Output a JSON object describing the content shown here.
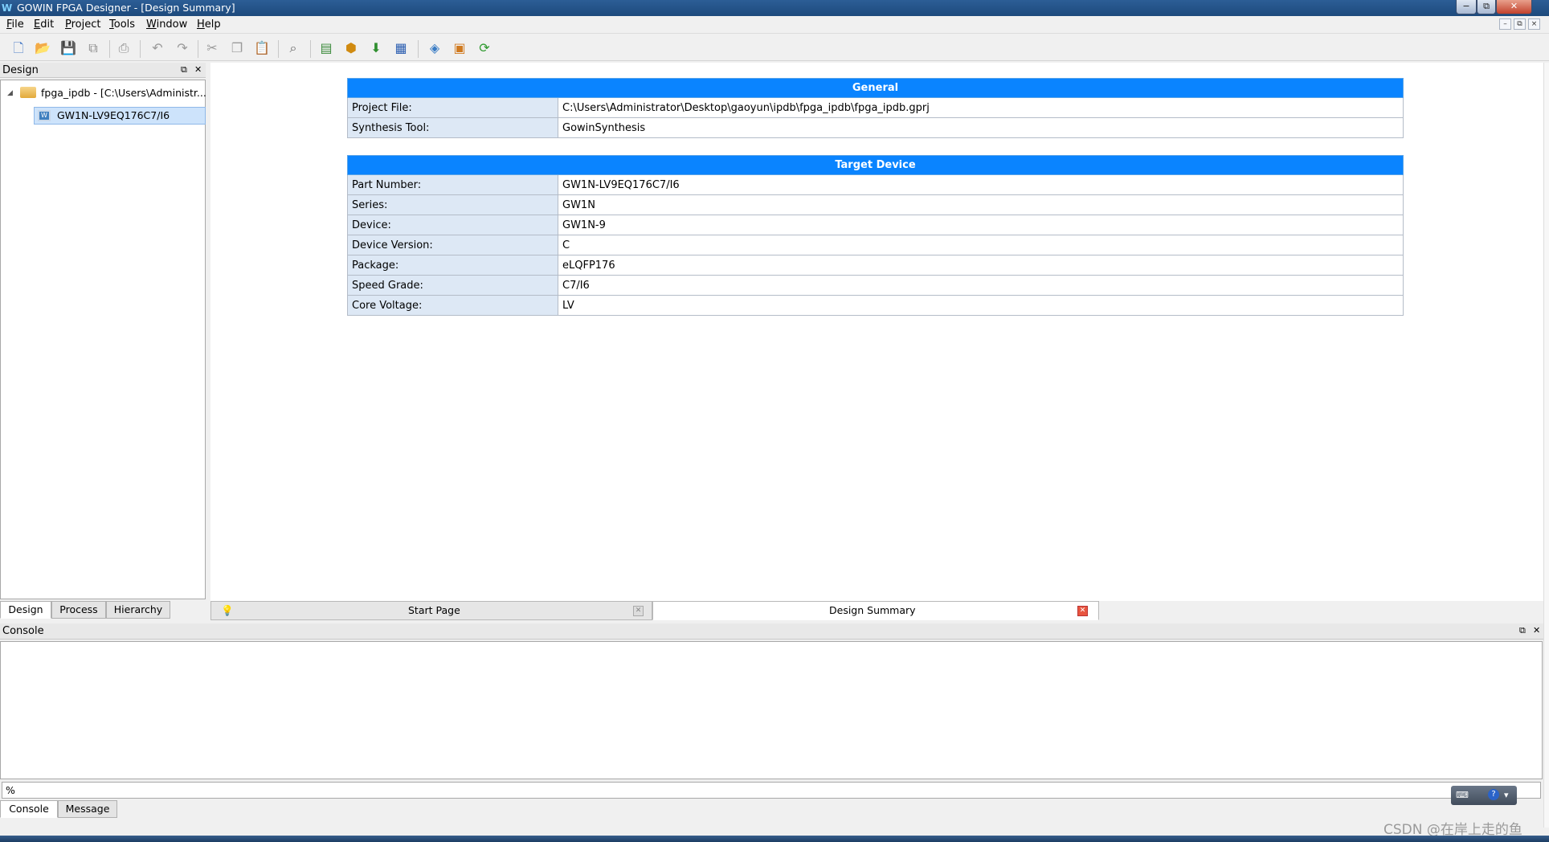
{
  "window": {
    "title": "GOWIN FPGA Designer - [Design Summary]",
    "logo_icon": "gowin-logo-icon",
    "controls": {
      "minimize": "−",
      "restore": "⧉",
      "close": "✕"
    }
  },
  "menu": {
    "items": [
      "File",
      "Edit",
      "Project",
      "Tools",
      "Window",
      "Help"
    ],
    "mdi_controls": {
      "minimize": "–",
      "restore": "⧉",
      "close": "×"
    }
  },
  "toolbar": {
    "icons": [
      "new-file-icon",
      "open-folder-icon",
      "save-icon",
      "save-all-icon",
      "print-icon",
      "undo-icon",
      "redo-icon",
      "cut-icon",
      "copy-icon",
      "paste-icon",
      "find-icon",
      "synthesize-icon",
      "place-route-icon",
      "program-device-icon",
      "schedule-icon",
      "ip-core-icon",
      "floorplanner-icon",
      "refresh-icon"
    ]
  },
  "design_panel": {
    "title": "Design",
    "float_icon": "⧉",
    "close_icon": "✕",
    "tree": {
      "expander": "◢",
      "project": "fpga_ipdb - [C:\\Users\\Administr...",
      "device": "GW1N-LV9EQ176C7/I6"
    },
    "tabs": [
      "Design",
      "Process",
      "Hierarchy"
    ]
  },
  "summary": {
    "general": {
      "header": "General",
      "rows": [
        {
          "key": "Project File:",
          "value": "C:\\Users\\Administrator\\Desktop\\gaoyun\\ipdb\\fpga_ipdb\\fpga_ipdb.gprj"
        },
        {
          "key": "Synthesis Tool:",
          "value": "GowinSynthesis"
        }
      ]
    },
    "target": {
      "header": "Target Device",
      "rows": [
        {
          "key": "Part Number:",
          "value": "GW1N-LV9EQ176C7/I6"
        },
        {
          "key": "Series:",
          "value": "GW1N"
        },
        {
          "key": "Device:",
          "value": "GW1N-9"
        },
        {
          "key": "Device Version:",
          "value": "C"
        },
        {
          "key": "Package:",
          "value": "eLQFP176"
        },
        {
          "key": "Speed Grade:",
          "value": "C7/I6"
        },
        {
          "key": "Core Voltage:",
          "value": "LV"
        }
      ]
    }
  },
  "doc_tabs": [
    {
      "label": "Start Page",
      "close": "✕"
    },
    {
      "label": "Design Summary",
      "close": "✕"
    }
  ],
  "console": {
    "title": "Console",
    "float_icon": "⧉",
    "close_icon": "✕",
    "prompt": "%",
    "tabs": [
      "Console",
      "Message"
    ]
  },
  "watermark": "CSDN @在岸上走的鱼"
}
